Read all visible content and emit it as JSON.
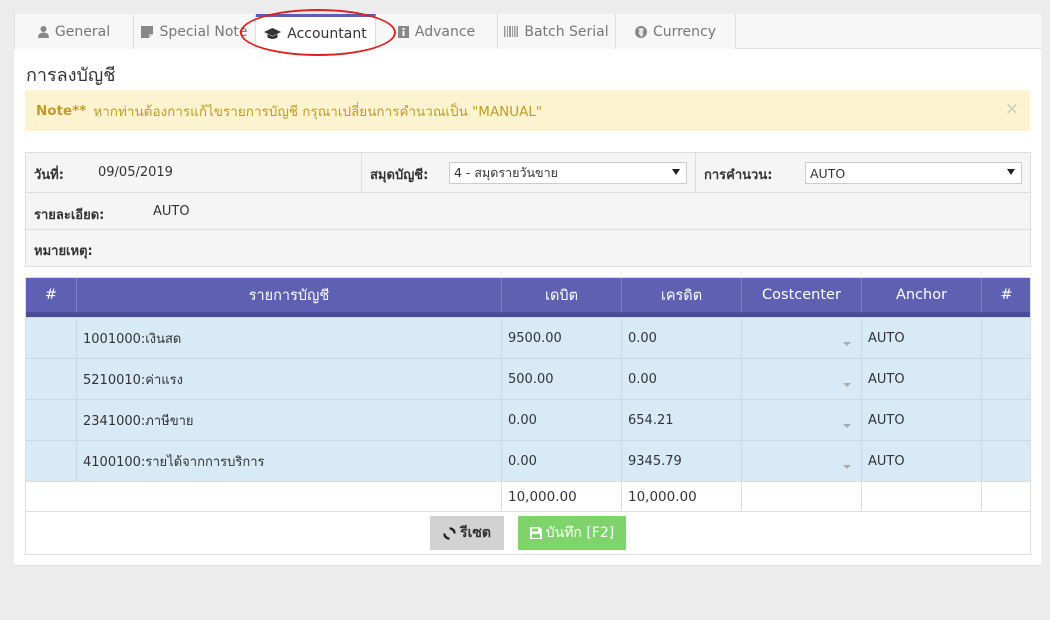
{
  "tabs": [
    {
      "label": "General",
      "icon": "user-icon"
    },
    {
      "label": "Special Note",
      "icon": "note-icon"
    },
    {
      "label": "Accountant",
      "icon": "graduation-cap-icon",
      "active": true
    },
    {
      "label": "Advance",
      "icon": "info-icon"
    },
    {
      "label": "Batch Serial",
      "icon": "barcode-icon"
    },
    {
      "label": "Currency",
      "icon": "globe-icon"
    }
  ],
  "page_title": "การลงบัญชี",
  "alert": {
    "strong": "Note**",
    "message": "หากท่านต้องการแก้ไขรายการบัญชี กรุณาเปลี่ยนการคำนวณเป็น \"MANUAL\"",
    "close": "×"
  },
  "form": {
    "date_label": "วันที่:",
    "date_value": "09/05/2019",
    "journal_label": "สมุดบัญชี:",
    "journal_value": "4 - สมุดรายวันขาย",
    "calc_label": "การคำนวน:",
    "calc_value": "AUTO",
    "detail_label": "รายละเอียด:",
    "detail_value": "AUTO",
    "remark_label": "หมายเหตุ:"
  },
  "grid": {
    "headers": [
      "#",
      "รายการบัญชี",
      "เดบิต",
      "เครดิต",
      "Costcenter",
      "Anchor",
      "#"
    ],
    "rows": [
      {
        "account": "1001000:เงินสด",
        "debit": "9500.00",
        "credit": "0.00",
        "anchor": "AUTO"
      },
      {
        "account": "5210010:ค่าแรง",
        "debit": "500.00",
        "credit": "0.00",
        "anchor": "AUTO"
      },
      {
        "account": "2341000:ภาษีขาย",
        "debit": "0.00",
        "credit": "654.21",
        "anchor": "AUTO"
      },
      {
        "account": "4100100:รายได้จากการบริการ",
        "debit": "0.00",
        "credit": "9345.79",
        "anchor": "AUTO"
      }
    ],
    "total_debit": "10,000.00",
    "total_credit": "10,000.00"
  },
  "buttons": {
    "reset": "รีเซต",
    "save": "บันทึก [F2]"
  },
  "colors": {
    "header": "#5e60b2",
    "row": "#d9eaf7",
    "alert_bg": "#fcf4d0",
    "alert_text": "#c09b26",
    "save": "#7ed36b",
    "annotation": "#e02020"
  }
}
